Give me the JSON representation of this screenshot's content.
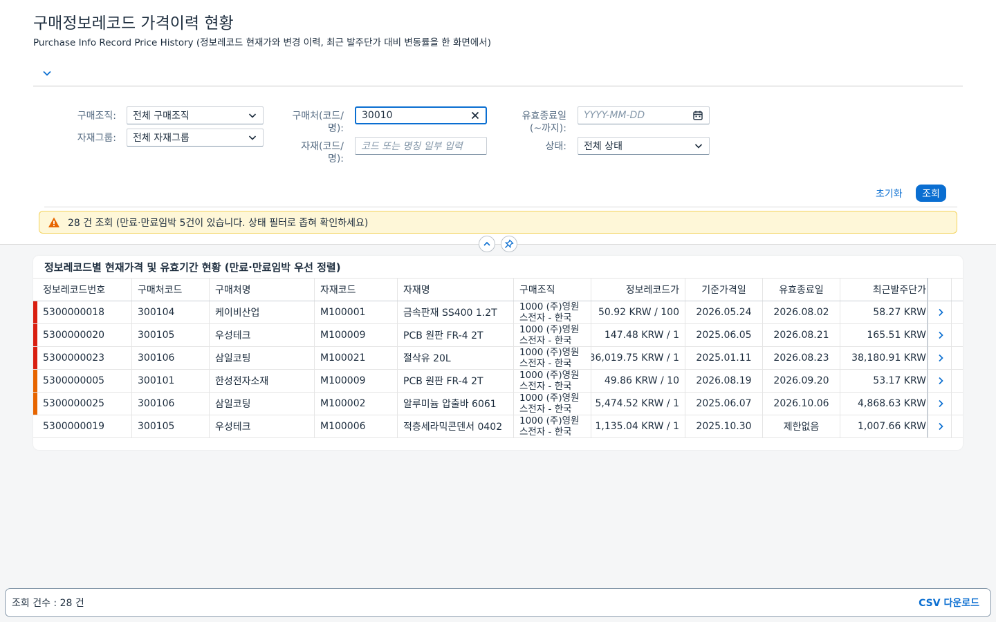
{
  "page": {
    "title": "구매정보레코드 가격이력 현황",
    "subtitle": "Purchase Info Record Price History (정보레코드 현재가와 변경 이력, 최근 발주단가 대비 변동률을 한 화면에서)"
  },
  "filters": {
    "purchase_org": {
      "label": "구매조직:",
      "value": "전체 구매조직"
    },
    "material_group": {
      "label": "자재그룹:",
      "value": "전체 자재그룹"
    },
    "vendor": {
      "label_line1": "구매처(코드/",
      "label_line2": "명):",
      "value": "30010"
    },
    "material": {
      "label_line1": "자재(코드/",
      "label_line2": "명):",
      "placeholder": "코드 또는 명칭 일부 입력"
    },
    "valid_to": {
      "label_line1": "유효종료일",
      "label_line2": "(~까지):",
      "placeholder": "YYYY-MM-DD"
    },
    "status": {
      "label": "상태:",
      "value": "전체 상태"
    }
  },
  "actions": {
    "reset": "초기화",
    "search": "조회"
  },
  "warning": {
    "text": "28 건 조회 (만료·만료임박 5건이 있습니다. 상태 필터로 좁혀 확인하세요)"
  },
  "table": {
    "title": "정보레코드별 현재가격 및 유효기간 현황 (만료·만료임박 우선 정렬)",
    "columns": [
      "정보레코드번호",
      "구매처코드",
      "구매처명",
      "자재코드",
      "자재명",
      "구매조직",
      "정보레코드가",
      "기준가격일",
      "유효종료일",
      "최근발주단가"
    ],
    "rows": [
      {
        "status_color": "#d91f11",
        "record_no": "5300000018",
        "vendor_code": "300104",
        "vendor_name": "케이비산업",
        "material_code": "M100001",
        "material_name": "금속판재 SS400 1.2T",
        "org": "1000 (주)영원스전자 - 한국",
        "record_price": "50.92 KRW / 100",
        "price_date": "2026.05.24",
        "valid_to": "2026.08.02",
        "last_po_price": "58.27 KRW"
      },
      {
        "status_color": "#d91f11",
        "record_no": "5300000020",
        "vendor_code": "300105",
        "vendor_name": "우성테크",
        "material_code": "M100009",
        "material_name": "PCB 원판 FR-4 2T",
        "org": "1000 (주)영원스전자 - 한국",
        "record_price": "147.48 KRW / 1",
        "price_date": "2025.06.05",
        "valid_to": "2026.08.21",
        "last_po_price": "165.51 KRW"
      },
      {
        "status_color": "#d91f11",
        "record_no": "5300000023",
        "vendor_code": "300106",
        "vendor_name": "삼일코팅",
        "material_code": "M100021",
        "material_name": "절삭유 20L",
        "org": "1000 (주)영원스전자 - 한국",
        "record_price": "36,019.75 KRW / 1",
        "price_date": "2025.01.11",
        "valid_to": "2026.08.23",
        "last_po_price": "38,180.91 KRW"
      },
      {
        "status_color": "#e76500",
        "record_no": "5300000005",
        "vendor_code": "300101",
        "vendor_name": "한성전자소재",
        "material_code": "M100009",
        "material_name": "PCB 원판 FR-4 2T",
        "org": "1000 (주)영원스전자 - 한국",
        "record_price": "49.86 KRW / 10",
        "price_date": "2026.08.19",
        "valid_to": "2026.09.20",
        "last_po_price": "53.17 KRW"
      },
      {
        "status_color": "#e76500",
        "record_no": "5300000025",
        "vendor_code": "300106",
        "vendor_name": "삼일코팅",
        "material_code": "M100002",
        "material_name": "알루미늄 압출바 6061",
        "org": "1000 (주)영원스전자 - 한국",
        "record_price": "5,474.52 KRW / 1",
        "price_date": "2025.06.07",
        "valid_to": "2026.10.06",
        "last_po_price": "4,868.63 KRW"
      },
      {
        "status_color": "",
        "record_no": "5300000019",
        "vendor_code": "300105",
        "vendor_name": "우성테크",
        "material_code": "M100006",
        "material_name": "적층세라믹콘덴서 0402",
        "org": "1000 (주)영원스전자 - 한국",
        "record_price": "1,135.04 KRW / 1",
        "price_date": "2025.10.30",
        "valid_to": "제한없음",
        "last_po_price": "1,007.66 KRW"
      }
    ]
  },
  "footer": {
    "count_text": "조회 건수 : 28 건",
    "csv_label": "CSV 다운로드"
  },
  "colors": {
    "accent": "#0a6ed1",
    "expired": "#d91f11",
    "expiring": "#e76500",
    "warning_bg": "#fef7d8"
  },
  "icons": [
    "chevron-down-icon",
    "close-icon",
    "calendar-icon",
    "warning-icon",
    "chevron-up-icon",
    "pin-icon",
    "chevron-right-icon"
  ]
}
